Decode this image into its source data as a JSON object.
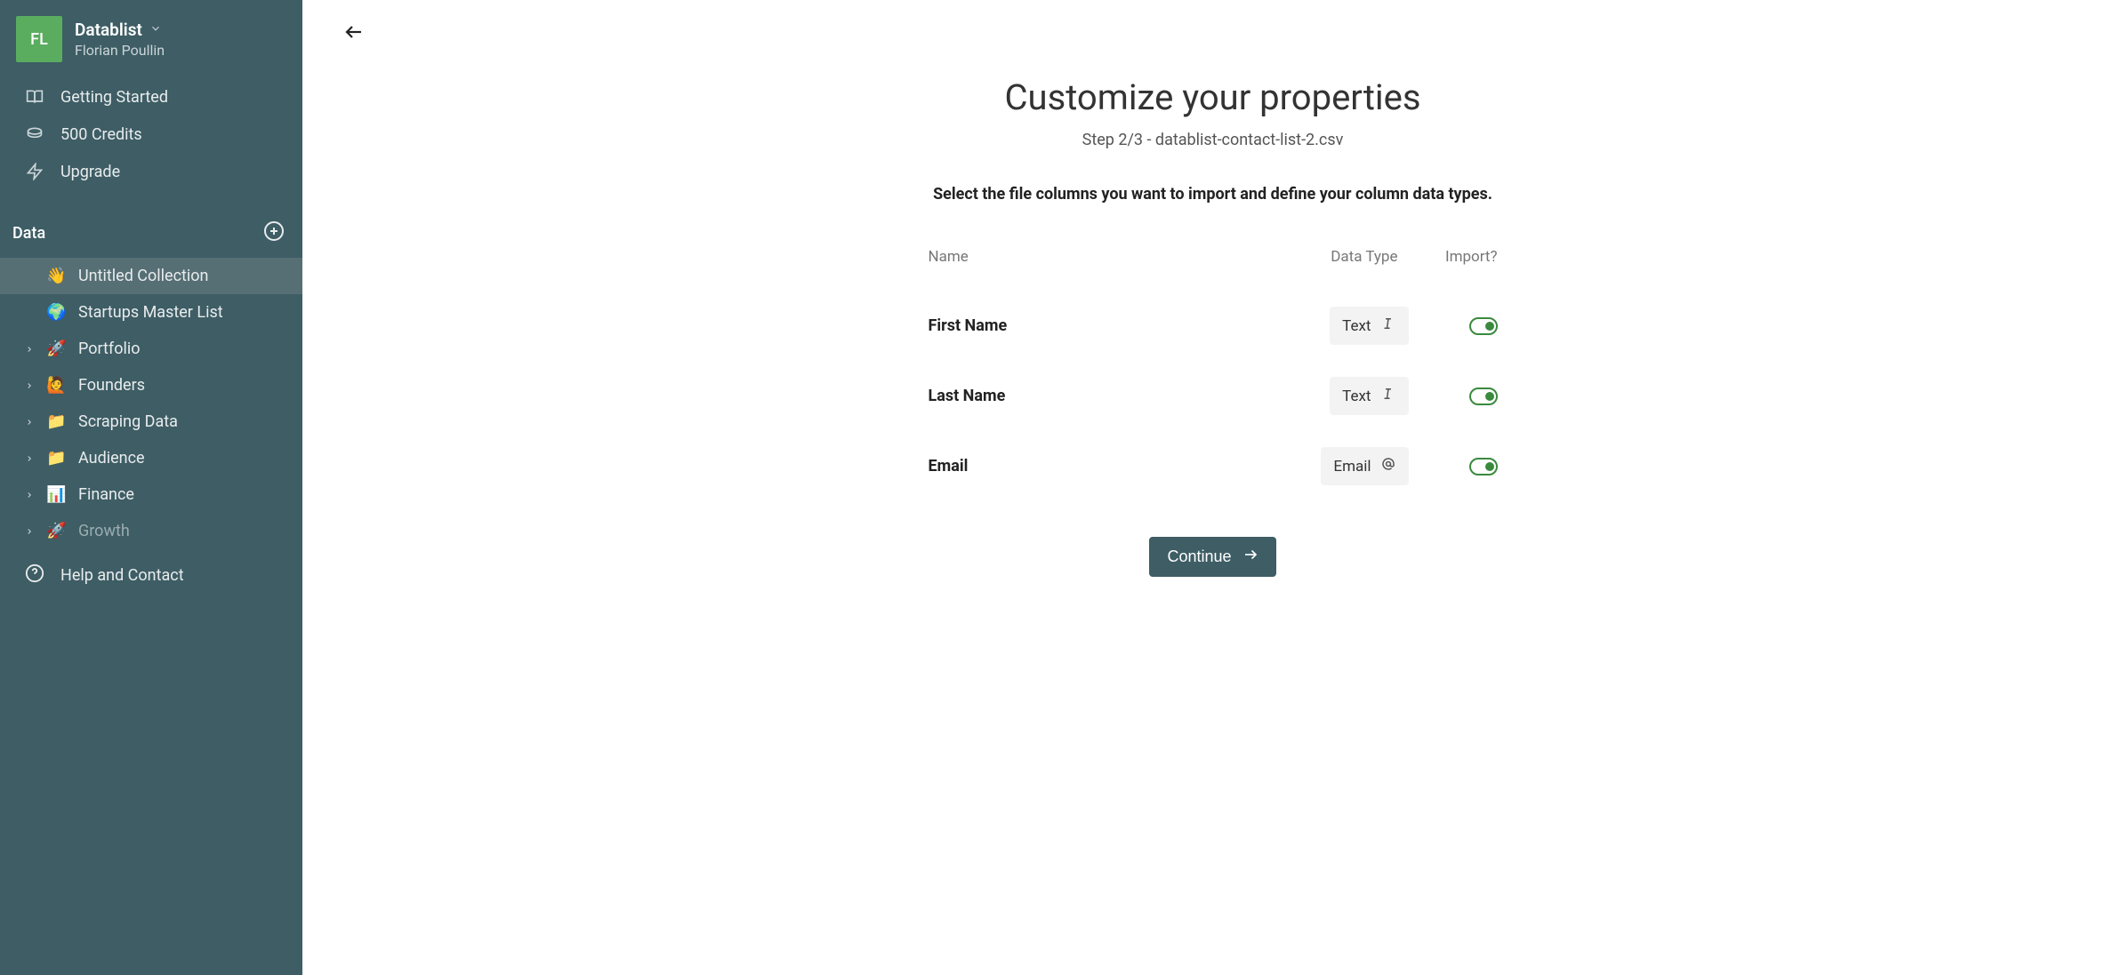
{
  "workspace": {
    "avatar_initials": "FL",
    "name": "Datablist",
    "user": "Florian Poullin"
  },
  "nav": {
    "getting_started": "Getting Started",
    "credits": "500 Credits",
    "upgrade": "Upgrade"
  },
  "data_section": {
    "label": "Data",
    "items": [
      {
        "emoji": "👋",
        "label": "Untitled Collection",
        "active": true,
        "expandable": false
      },
      {
        "emoji": "🌍",
        "label": "Startups Master List",
        "active": false,
        "expandable": false
      },
      {
        "emoji": "🚀",
        "label": "Portfolio",
        "active": false,
        "expandable": true
      },
      {
        "emoji": "🙋",
        "label": "Founders",
        "active": false,
        "expandable": true
      },
      {
        "emoji": "📁",
        "label": "Scraping Data",
        "active": false,
        "expandable": true
      },
      {
        "emoji": "📁",
        "label": "Audience",
        "active": false,
        "expandable": true
      },
      {
        "emoji": "📊",
        "label": "Finance",
        "active": false,
        "expandable": true
      },
      {
        "emoji": "🚀",
        "label": "Growth",
        "active": false,
        "expandable": true,
        "faded": true
      }
    ]
  },
  "help": {
    "label": "Help and Contact"
  },
  "main": {
    "title": "Customize your properties",
    "subtitle": "Step 2/3 - datablist-contact-list-2.csv",
    "instruction": "Select the file columns you want to import and define your column data types.",
    "headers": {
      "name": "Name",
      "type": "Data Type",
      "import": "Import?"
    },
    "rows": [
      {
        "name": "First Name",
        "type": "Text",
        "type_icon": "text"
      },
      {
        "name": "Last Name",
        "type": "Text",
        "type_icon": "text"
      },
      {
        "name": "Email",
        "type": "Email",
        "type_icon": "email"
      }
    ],
    "continue": "Continue"
  }
}
